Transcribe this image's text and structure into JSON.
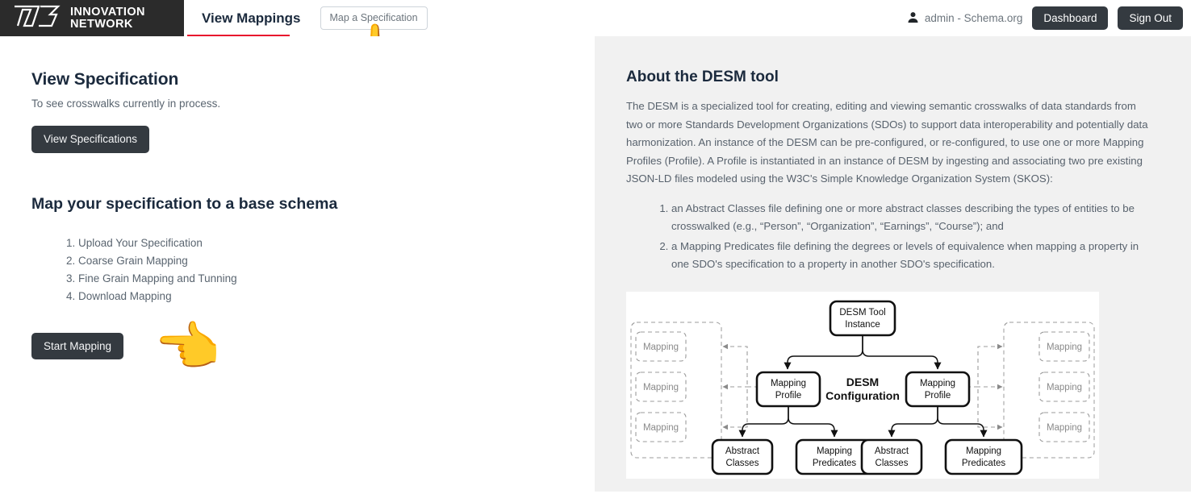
{
  "header": {
    "brand": {
      "line1": "INNOVATION",
      "line2": "NETWORK",
      "mark": "t3-logo-icon"
    },
    "tab_view_mappings": "View Mappings",
    "btn_map_specification": "Map a Specification",
    "user": {
      "icon": "user-icon",
      "label": "admin - Schema.org"
    },
    "btn_dashboard": "Dashboard",
    "btn_sign_out": "Sign Out",
    "accent_color": "#e8112d",
    "brand_bg": "#2b2b2b"
  },
  "left": {
    "view_spec_title": "View Specification",
    "view_spec_sub": "To see crosswalks currently in process.",
    "btn_view_specifications": "View Specifications",
    "map_title": "Map your specification to a base schema",
    "steps": [
      "Upload Your Specification",
      "Coarse Grain Mapping",
      "Fine Grain Mapping and Tunning",
      "Download Mapping"
    ],
    "btn_start_mapping": "Start Mapping",
    "cursor_hand": "👈"
  },
  "top_cursor_hand": "☝️",
  "right": {
    "about_title": "About the DESM tool",
    "about_body": "The DESM is a specialized tool for creating, editing and viewing semantic crosswalks of data standards from two or more Standards Development Organizations (SDOs) to support data interoperability and potentially data harmonization. An instance of the DESM can be pre-configured, or re-configured, to use one or more Mapping Profiles (Profile). A Profile is instantiated in an instance of DESM by ingesting and associating two pre existing JSON-LD files modeled using the W3C's Simple Knowledge Organization System (SKOS):",
    "about_list": [
      "an Abstract Classes file defining one or more abstract classes describing the types of entities to be crosswalked (e.g., “Person”, “Organization”, “Earnings”, “Course”); and",
      "a Mapping Predicates file defining the degrees or levels of equivalence when mapping a property in one SDO's specification to a property in another SDO's specification."
    ],
    "diagram": {
      "root": "DESM Tool Instance",
      "center_label_line1": "DESM",
      "center_label_line2": "Configuration",
      "profile_left": "Mapping Profile",
      "profile_right": "Mapping Profile",
      "leaf_abstract_classes": "Abstract Classes",
      "leaf_mapping_predicates": "Mapping Predicates",
      "mapping_box": "Mapping",
      "left_mappings": [
        "Mapping",
        "Mapping",
        "Mapping"
      ],
      "right_mappings": [
        "Mapping",
        "Mapping",
        "Mapping"
      ]
    }
  }
}
